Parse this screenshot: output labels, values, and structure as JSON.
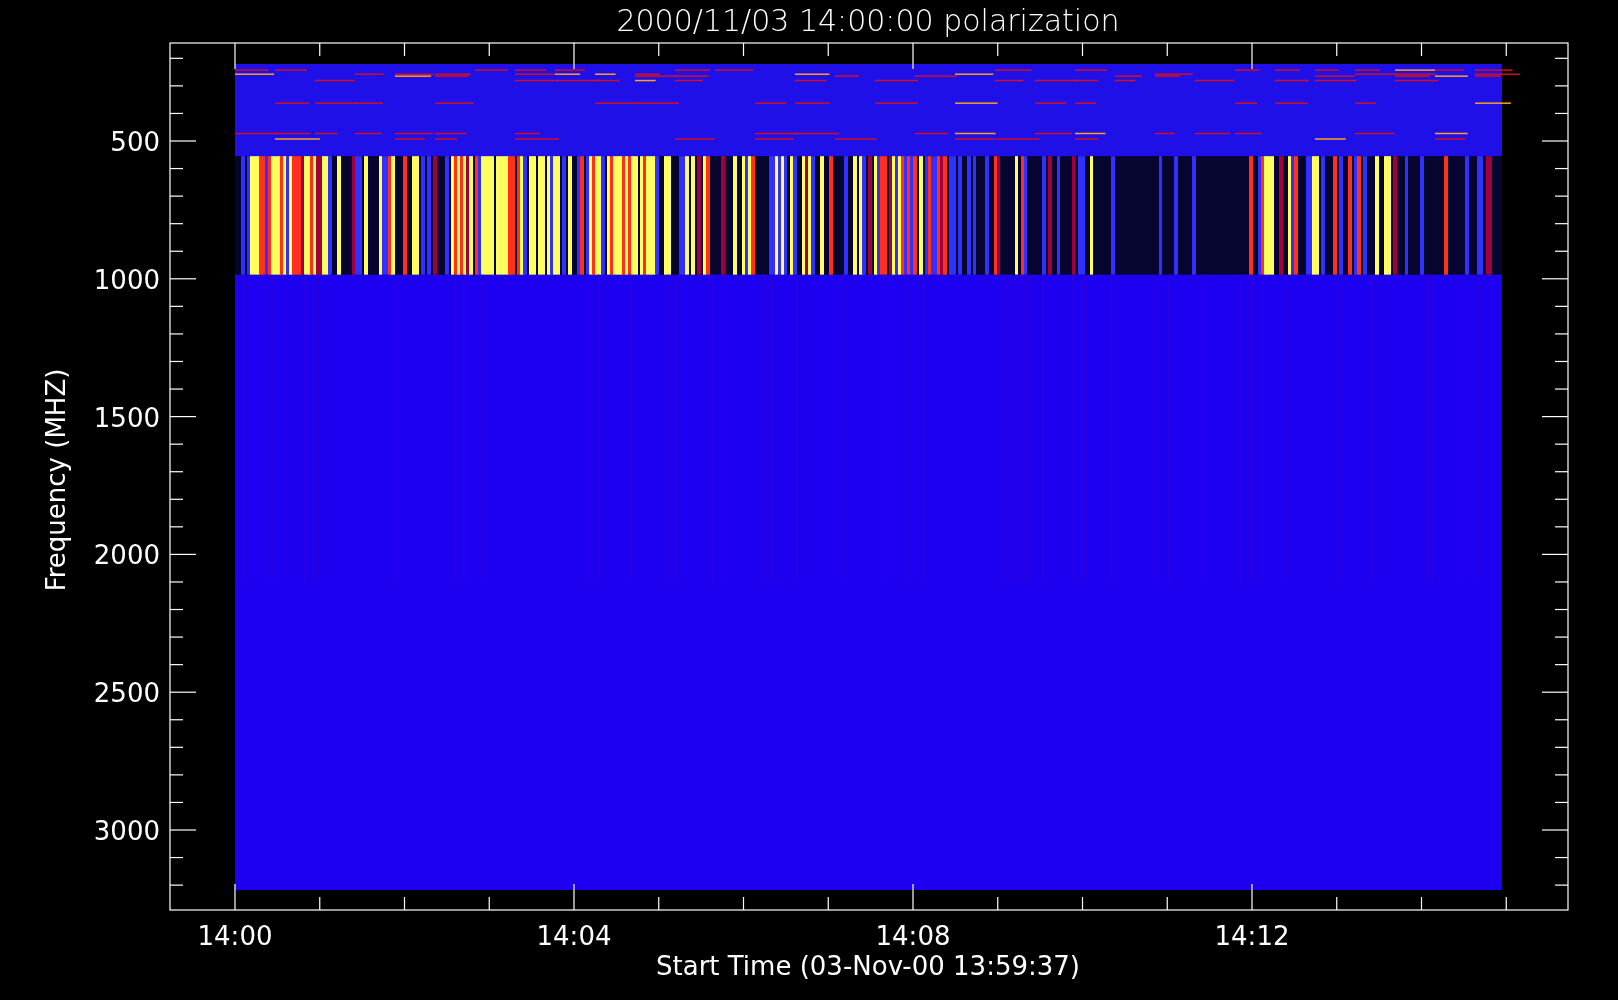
{
  "plot": {
    "title": "2000/11/03 14:00:00 polarization",
    "ylabel": "Frequency (MHZ)",
    "xlabel": "Start Time (03-Nov-00 13:59:37)",
    "yticks": [
      "500",
      "1000",
      "1500",
      "2000",
      "2500",
      "3000"
    ],
    "xticks": [
      "14:00",
      "14:04",
      "14:08",
      "14:12"
    ]
  }
}
